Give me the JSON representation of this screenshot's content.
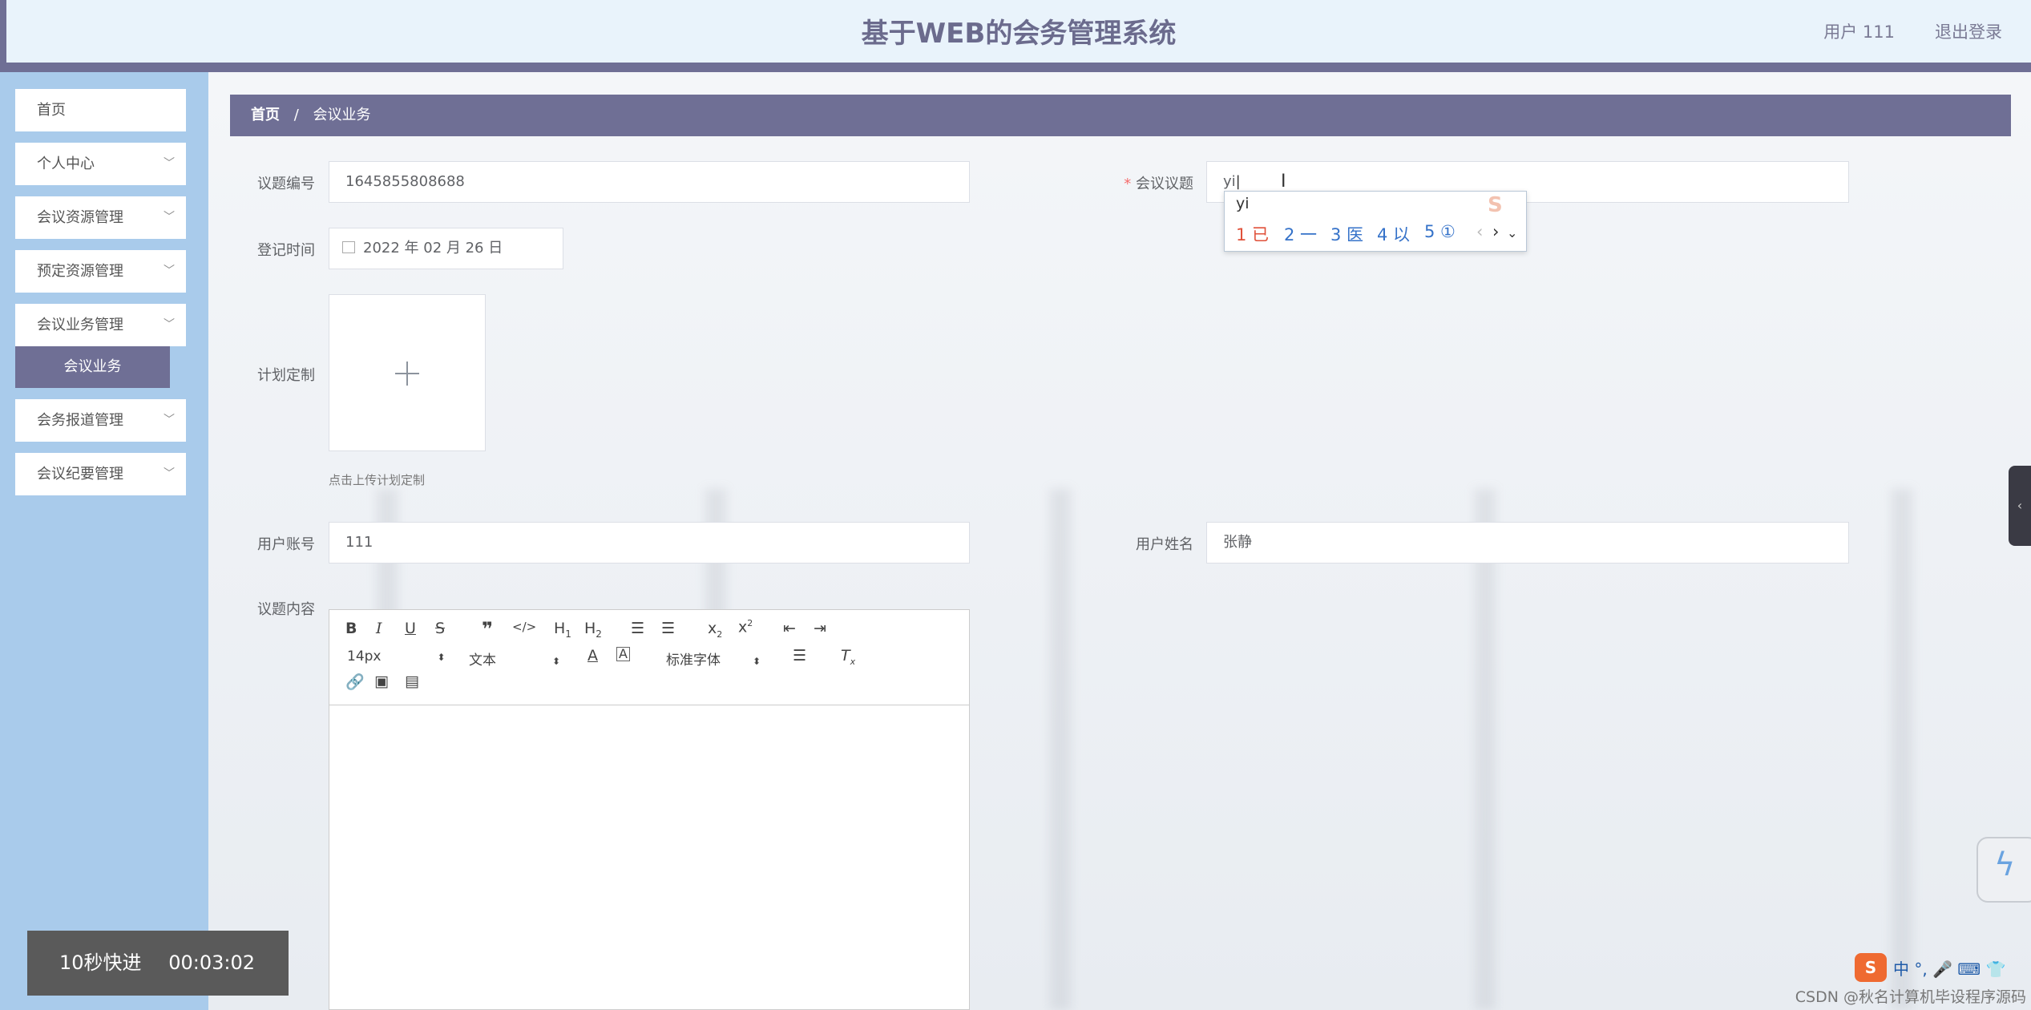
{
  "header": {
    "title": "基于WEB的会务管理系统",
    "user": "用户 111",
    "logout": "退出登录"
  },
  "sidebar": {
    "items": [
      {
        "label": "首页",
        "chevron": false
      },
      {
        "label": "个人中心",
        "chevron": true
      },
      {
        "label": "会议资源管理",
        "chevron": true
      },
      {
        "label": "预定资源管理",
        "chevron": true
      },
      {
        "label": "会议业务管理",
        "chevron": true
      },
      {
        "label": "会务报道管理",
        "chevron": true
      },
      {
        "label": "会议纪要管理",
        "chevron": true
      }
    ],
    "active_sub": "会议业务"
  },
  "breadcrumb": {
    "home": "首页",
    "sep": "/",
    "current": "会议业务"
  },
  "form": {
    "topic_no_label": "议题编号",
    "topic_no_value": "1645855808688",
    "topic_label_star": "*",
    "topic_label": "会议议题",
    "topic_value": "yi",
    "reg_time_label": "登记时间",
    "reg_time_value": "2022 年 02 月 26 日",
    "plan_label": "计划定制",
    "plan_hint": "点击上传计划定制",
    "account_label": "用户账号",
    "account_value": "111",
    "name_label": "用户姓名",
    "name_value": "张静",
    "content_label": "议题内容"
  },
  "editor": {
    "font_size": "14px",
    "paragraph": "文本",
    "font_family": "标准字体"
  },
  "ime": {
    "composition": "yi",
    "candidates": [
      "1 已",
      "2 一",
      "3 医",
      "4 以",
      "5 ①"
    ]
  },
  "overlay": {
    "fast_forward": "10秒快进",
    "timestamp": "00:03:02",
    "watermark": "CSDN @秋名计算机毕设程序源码",
    "tray_logo": "S",
    "tray_text": "中 °, 🎤 ⌨ 👕"
  }
}
